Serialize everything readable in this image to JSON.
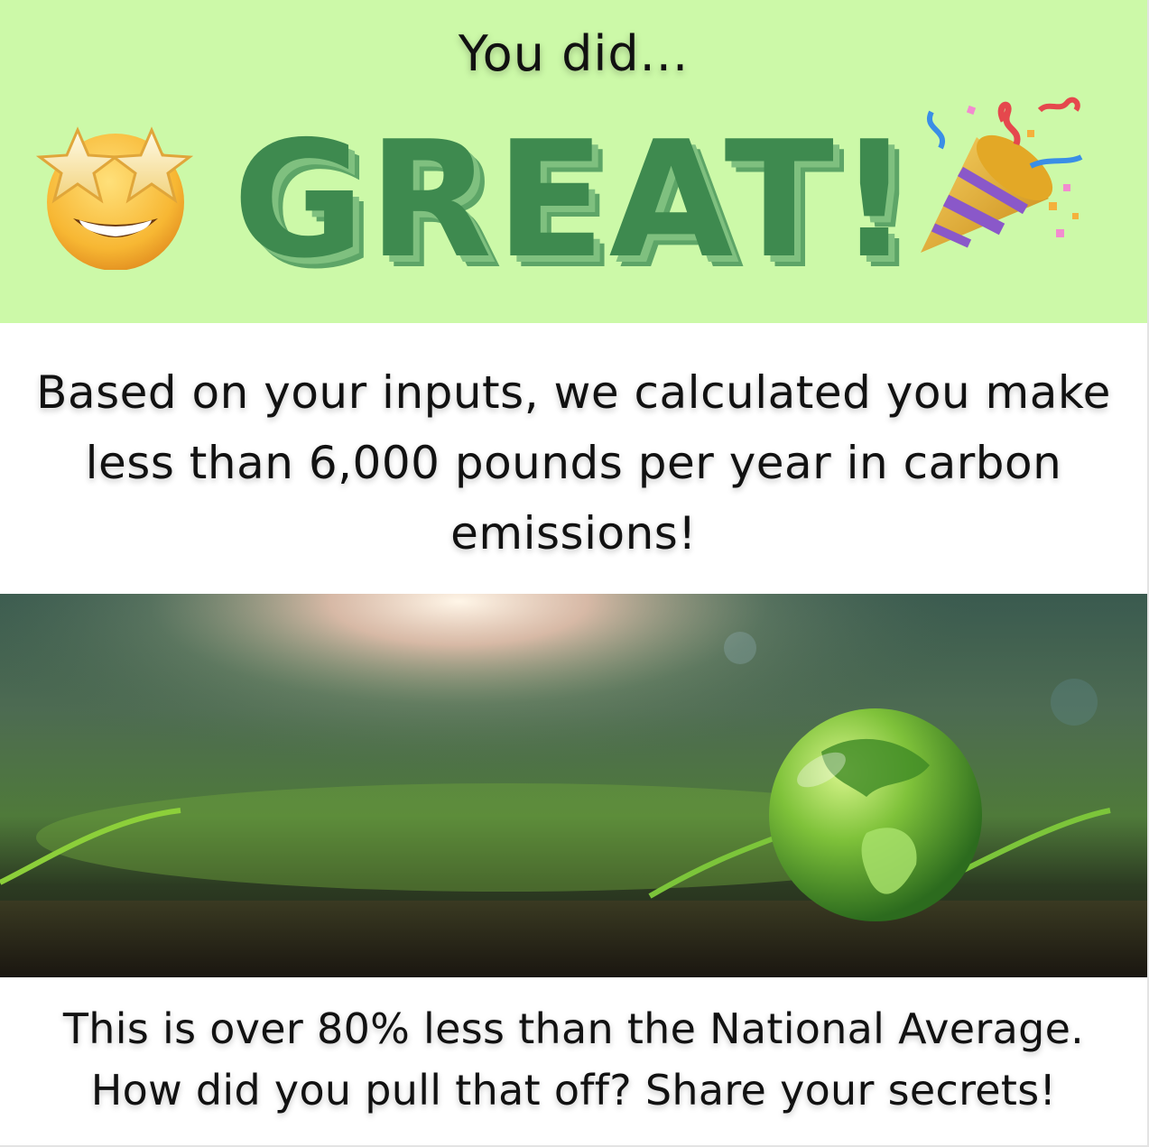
{
  "header": {
    "intro": "You did...",
    "rating": "GREAT!"
  },
  "icons": {
    "left": "star-struck-emoji-icon",
    "right": "party-popper-emoji-icon"
  },
  "result_text": "Based on your inputs, we calculated you make less than 6,000 pounds per year in carbon emissions!",
  "image": {
    "subject": "glass-earth-globe-on-forest-soil-photo"
  },
  "comparison_text": "This is over 80% less than the National Average. How did you pull that off? Share your secrets!",
  "colors": {
    "header_bg": "#ccf9a8",
    "great_text": "#3e8a4f",
    "great_shadow": "#7fc07f"
  }
}
